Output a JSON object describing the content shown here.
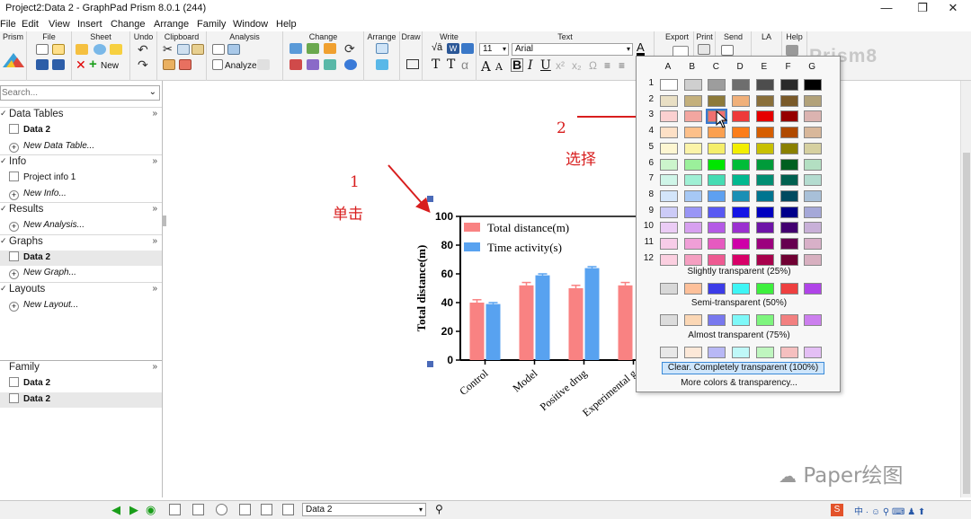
{
  "window": {
    "title": "Project2:Data 2 - GraphPad Prism 8.0.1 (244)",
    "minimize": "—",
    "restore": "❐",
    "close": "✕"
  },
  "menu": [
    "File",
    "Edit",
    "View",
    "Insert",
    "Change",
    "Arrange",
    "Family",
    "Window",
    "Help"
  ],
  "ribbon": {
    "groups": [
      "Prism",
      "File",
      "Sheet",
      "Undo",
      "Clipboard",
      "Analysis",
      "Change",
      "Arrange",
      "Draw",
      "Write",
      "Text",
      "Export",
      "Print",
      "Send",
      "LA",
      "Help"
    ],
    "new_label": "New",
    "analyze_label": "Analyze",
    "font_size": "11",
    "font_name": "Arial",
    "brand": "Prism8"
  },
  "sidebar": {
    "search_placeholder": "Search...",
    "sections": [
      {
        "label": "Data Tables",
        "items": [
          {
            "label": "Data 2",
            "bold": true
          },
          {
            "label": "New Data Table...",
            "italic": true
          }
        ]
      },
      {
        "label": "Info",
        "items": [
          {
            "label": "Project info 1"
          },
          {
            "label": "New Info...",
            "italic": true
          }
        ]
      },
      {
        "label": "Results",
        "items": [
          {
            "label": "New Analysis...",
            "italic": true
          }
        ]
      },
      {
        "label": "Graphs",
        "items": [
          {
            "label": "Data 2",
            "bold": true,
            "selected": true
          },
          {
            "label": "New Graph...",
            "italic": true
          }
        ]
      },
      {
        "label": "Layouts",
        "items": [
          {
            "label": "New Layout...",
            "italic": true
          }
        ]
      }
    ],
    "family": {
      "label": "Family",
      "items": [
        {
          "label": "Data 2",
          "bold": true
        },
        {
          "label": "Data 2",
          "bold": true,
          "selected": true
        }
      ]
    }
  },
  "annotations": {
    "step1_num": "1",
    "step1_text": "单击",
    "step2_num": "2",
    "step2_text": "选择"
  },
  "chart_data": {
    "type": "bar",
    "categories": [
      "Control",
      "Model",
      "Positive drug",
      "Experimental g"
    ],
    "series": [
      {
        "name": "Total distance(m)",
        "color": "#f98282",
        "values": [
          40,
          52,
          50,
          52
        ],
        "errors": [
          2,
          2,
          2,
          2
        ]
      },
      {
        "name": "Time activity(s)",
        "color": "#58a2f0",
        "values": [
          39,
          59,
          64,
          null
        ],
        "errors": [
          1,
          1,
          1,
          0
        ]
      }
    ],
    "ylabel": "Total distance(m)",
    "yticks": [
      "0",
      "20",
      "40",
      "60",
      "80",
      "100"
    ],
    "ylim": [
      0,
      100
    ]
  },
  "palette": {
    "columns": [
      "A",
      "B",
      "C",
      "D",
      "E",
      "F",
      "G"
    ],
    "rows": [
      [
        "#ffffff",
        "#cfcfcf",
        "#9d9d9d",
        "#6e6e6e",
        "#4d4d4d",
        "#2a2a2a",
        "#000000"
      ],
      [
        "#e9dfc4",
        "#c4b07c",
        "#8d7a3a",
        "#f0b07a",
        "#8a6f3a",
        "#7a5a2a",
        "#b2a27a"
      ],
      [
        "#fbd0d0",
        "#f3a6a0",
        "#f07070",
        "#ee3a3a",
        "#e60000",
        "#960000",
        "#dbb3b0"
      ],
      [
        "#fde0c6",
        "#fdc08a",
        "#fba050",
        "#fb7d1a",
        "#d65e00",
        "#b04a00",
        "#d8b79a"
      ],
      [
        "#fdf6d2",
        "#fbf3a8",
        "#f5ee6a",
        "#f2ee00",
        "#c8c000",
        "#8a8000",
        "#d6d0a0"
      ],
      [
        "#ccf5cc",
        "#9bf09b",
        "#00e600",
        "#00bd38",
        "#009b3a",
        "#006020",
        "#b3dfc2"
      ],
      [
        "#cff5e8",
        "#9ff0d5",
        "#45dcb3",
        "#00b88f",
        "#008e73",
        "#006050",
        "#b4dcd0"
      ],
      [
        "#d3e5fa",
        "#a6c8f5",
        "#5ea0f0",
        "#1a8fb5",
        "#007590",
        "#004a60",
        "#a8c0d8"
      ],
      [
        "#cccbf7",
        "#9995f5",
        "#5858f2",
        "#1414e5",
        "#0000c0",
        "#00008a",
        "#a5a8d8"
      ],
      [
        "#ebccf5",
        "#d7a0f0",
        "#b45ae6",
        "#9b30d0",
        "#6e14a8",
        "#420070",
        "#c8b0d8"
      ],
      [
        "#f7cce8",
        "#f09fd7",
        "#e65ac0",
        "#cf00a8",
        "#9c007e",
        "#660050",
        "#d8b0c8"
      ],
      [
        "#fbcfe0",
        "#f59fc1",
        "#ee5a92",
        "#d80068",
        "#a8004c",
        "#700033",
        "#d8b0c0"
      ]
    ],
    "slightly": {
      "label": "Slightly transparent (25%)",
      "colors": [
        "#d8d8d8",
        "#fdc09a",
        "#3c3ce8",
        "#3ef5f5",
        "#3ef03e",
        "#ee4040",
        "#b044e8"
      ]
    },
    "semi": {
      "label": "Semi-transparent (50%)",
      "colors": [
        "#dcdcdc",
        "#fbd7b5",
        "#7878ee",
        "#7ef8f8",
        "#7ef57e",
        "#f28080",
        "#cc7fee"
      ]
    },
    "almost": {
      "label": "Almost transparent (75%)",
      "colors": [
        "#e8e8e8",
        "#fce8d8",
        "#b8b8f5",
        "#bff8f8",
        "#bff6bf",
        "#f5bfbf",
        "#e4bff5"
      ]
    },
    "clear_label": "Clear. Completely transparent (100%)",
    "more_label": "More colors & transparency..."
  },
  "statusbar": {
    "sheet_select": "Data 2"
  },
  "watermark": "Paper绘图"
}
